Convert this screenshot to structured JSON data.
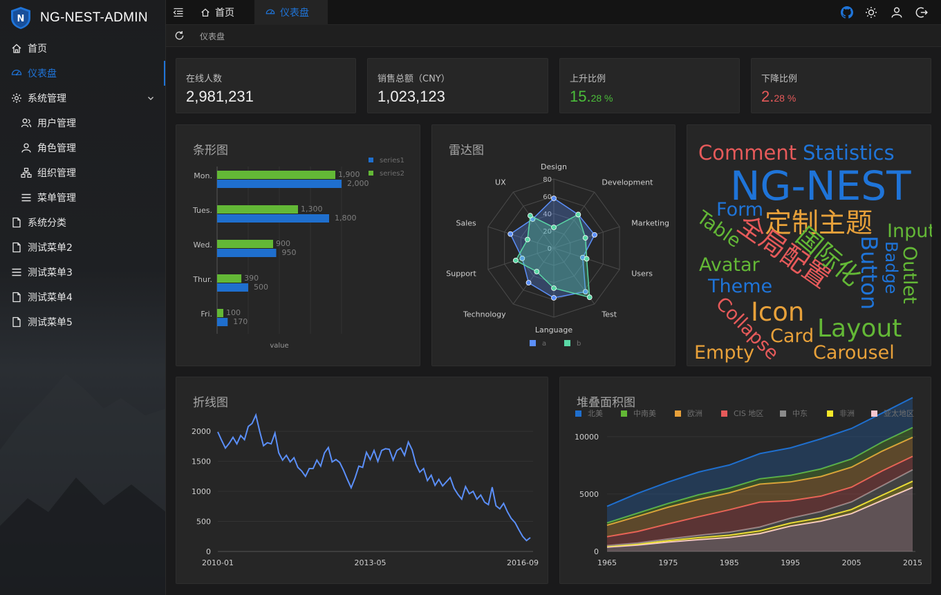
{
  "app": {
    "title": "NG-NEST-ADMIN"
  },
  "sidebar": {
    "items": [
      {
        "label": "首页",
        "icon": "home-icon"
      },
      {
        "label": "仪表盘",
        "icon": "dashboard-icon",
        "active": true
      },
      {
        "label": "系统管理",
        "icon": "gear-icon",
        "expandable": true
      },
      {
        "label": "用户管理",
        "icon": "user-group-icon"
      },
      {
        "label": "角色管理",
        "icon": "user-icon"
      },
      {
        "label": "组织管理",
        "icon": "org-icon"
      },
      {
        "label": "菜单管理",
        "icon": "menu-icon"
      },
      {
        "label": "系统分类",
        "icon": "file-icon"
      },
      {
        "label": "测试菜单2",
        "icon": "file-icon"
      },
      {
        "label": "测试菜单3",
        "icon": "menu-icon"
      },
      {
        "label": "测试菜单4",
        "icon": "file-icon"
      },
      {
        "label": "测试菜单5",
        "icon": "file-icon"
      }
    ]
  },
  "tabs": [
    {
      "label": "首页",
      "icon": "home-icon"
    },
    {
      "label": "仪表盘",
      "icon": "dashboard-icon",
      "active": true
    }
  ],
  "breadcrumb": {
    "current": "仪表盘"
  },
  "colors": {
    "accent": "#1f74d8",
    "up": "#4bbf3a",
    "down": "#e65a5a"
  },
  "stats": [
    {
      "label": "在线人数",
      "value": "2,981,231"
    },
    {
      "label": "销售总额（CNY）",
      "value": "1,023,123"
    },
    {
      "label": "上升比例",
      "int": "15.",
      "dec": "28 %"
    },
    {
      "label": "下降比例",
      "int": "2.",
      "dec": "28 %"
    }
  ],
  "charts": {
    "bar": {
      "title": "条形图"
    },
    "radar": {
      "title": "雷达图"
    },
    "line": {
      "title": "折线图"
    },
    "area": {
      "title": "堆叠面积图"
    }
  },
  "chart_data": [
    {
      "type": "bar",
      "orientation": "horizontal",
      "categories": [
        "Mon.",
        "Tues.",
        "Wed.",
        "Thur.",
        "Fri."
      ],
      "series": [
        {
          "name": "series1",
          "color": "#1f6fce",
          "values": [
            2000,
            1800,
            950,
            500,
            170
          ]
        },
        {
          "name": "series2",
          "color": "#63b836",
          "values": [
            1900,
            1300,
            900,
            390,
            100
          ]
        }
      ],
      "data_labels": {
        "series1": [
          "2,000",
          "1,800",
          "950",
          "500",
          "170"
        ],
        "series2": [
          "1,900",
          "1,300",
          "900",
          "390",
          "100"
        ]
      },
      "xlabel": "value",
      "xlim": [
        0,
        2000
      ],
      "legend": "top-right"
    },
    {
      "type": "radar",
      "indicators": [
        "Design",
        "Development",
        "Marketing",
        "Users",
        "Test",
        "Language",
        "Technology",
        "Support",
        "Sales",
        "UX"
      ],
      "ticks": [
        "0",
        "20",
        "40",
        "60",
        "80"
      ],
      "max": 100,
      "series": [
        {
          "name": "a",
          "color": "#5b8ff9",
          "values": [
            72,
            60,
            62,
            44,
            78,
            72,
            62,
            48,
            66,
            52
          ]
        },
        {
          "name": "b",
          "color": "#5ad8a6",
          "values": [
            30,
            60,
            48,
            50,
            88,
            58,
            42,
            58,
            40,
            58
          ]
        }
      ],
      "legend": "bottom-center"
    },
    {
      "type": "wordcloud",
      "words": [
        {
          "text": "NG-NEST",
          "color": "#1f74d8"
        },
        {
          "text": "Comment",
          "color": "#e65a5a"
        },
        {
          "text": "Statistics",
          "color": "#1f74d8"
        },
        {
          "text": "Form",
          "color": "#1f74d8"
        },
        {
          "text": "定制主题",
          "color": "#e8a13a"
        },
        {
          "text": "Table",
          "color": "#63b836"
        },
        {
          "text": "全局配置",
          "color": "#e65a5a"
        },
        {
          "text": "国际化",
          "color": "#63b836"
        },
        {
          "text": "Button",
          "color": "#1f74d8"
        },
        {
          "text": "Input",
          "color": "#63b836"
        },
        {
          "text": "Badge",
          "color": "#1f74d8"
        },
        {
          "text": "Outlet",
          "color": "#63b836"
        },
        {
          "text": "Avatar",
          "color": "#63b836"
        },
        {
          "text": "Theme",
          "color": "#1f74d8"
        },
        {
          "text": "Icon",
          "color": "#e8a13a"
        },
        {
          "text": "Collapse",
          "color": "#e65a5a"
        },
        {
          "text": "Layout",
          "color": "#63b836"
        },
        {
          "text": "Card",
          "color": "#e8a13a"
        },
        {
          "text": "Empty",
          "color": "#e8a13a"
        },
        {
          "text": "Carousel",
          "color": "#e8a13a"
        }
      ]
    },
    {
      "type": "line",
      "color": "#5b8ff9",
      "x_ticks": [
        "2010-01",
        "2013-05",
        "2016-09"
      ],
      "y_ticks": [
        "0",
        "500",
        "1000",
        "1500",
        "2000"
      ],
      "ylim": [
        0,
        2300
      ],
      "x": [
        "2010-01",
        "2010-02",
        "2010-03",
        "2010-04",
        "2010-05",
        "2010-06",
        "2010-07",
        "2010-08",
        "2010-09",
        "2010-10",
        "2010-11",
        "2010-12",
        "2011-01",
        "2011-02",
        "2011-03",
        "2011-04",
        "2011-05",
        "2011-06",
        "2011-07",
        "2011-08",
        "2011-09",
        "2011-10",
        "2011-11",
        "2011-12",
        "2012-01",
        "2012-02",
        "2012-03",
        "2012-04",
        "2012-05",
        "2012-06",
        "2012-07",
        "2012-08",
        "2012-09",
        "2012-10",
        "2012-11",
        "2012-12",
        "2013-01",
        "2013-02",
        "2013-03",
        "2013-04",
        "2013-05",
        "2013-06",
        "2013-07",
        "2013-08",
        "2013-09",
        "2013-10",
        "2013-11",
        "2013-12",
        "2014-01",
        "2014-02",
        "2014-03",
        "2014-04",
        "2014-05",
        "2014-06",
        "2014-07",
        "2014-08",
        "2014-09",
        "2014-10",
        "2014-11",
        "2014-12",
        "2015-01",
        "2015-02",
        "2015-03",
        "2015-04",
        "2015-05",
        "2015-06",
        "2015-07",
        "2015-08",
        "2015-09",
        "2015-10",
        "2015-11",
        "2015-12",
        "2016-01",
        "2016-02",
        "2016-03",
        "2016-04",
        "2016-05",
        "2016-06",
        "2016-07",
        "2016-08",
        "2016-09",
        "2016-10",
        "2016-11"
      ],
      "values": [
        1990,
        1850,
        1720,
        1800,
        1900,
        1790,
        1930,
        1860,
        2080,
        2130,
        2270,
        2000,
        1760,
        1810,
        1790,
        1970,
        1640,
        1520,
        1600,
        1490,
        1560,
        1400,
        1340,
        1250,
        1380,
        1380,
        1520,
        1420,
        1640,
        1730,
        1490,
        1530,
        1480,
        1350,
        1200,
        1060,
        1220,
        1420,
        1400,
        1650,
        1530,
        1680,
        1500,
        1680,
        1710,
        1700,
        1520,
        1680,
        1720,
        1600,
        1820,
        1690,
        1450,
        1320,
        1380,
        1180,
        1270,
        1100,
        1200,
        1090,
        1160,
        1230,
        1050,
        950,
        870,
        1080,
        960,
        1000,
        870,
        940,
        820,
        780,
        1070,
        760,
        710,
        800,
        660,
        550,
        480,
        360,
        250,
        180,
        230
      ],
      "grid": true
    },
    {
      "type": "area",
      "stacked": true,
      "x": [
        1965,
        1970,
        1975,
        1980,
        1985,
        1990,
        1995,
        2000,
        2005,
        2010,
        2015
      ],
      "x_ticks": [
        "1965",
        "1975",
        "1985",
        "1995",
        "2005",
        "2015"
      ],
      "y_ticks": [
        "0",
        "5000",
        "10000"
      ],
      "ylim": [
        0,
        13000
      ],
      "series": [
        {
          "name": "亚太地区",
          "color": "#f5c6cf",
          "values": [
            380,
            560,
            820,
            1030,
            1220,
            1560,
            2210,
            2640,
            3300,
            4450,
            5580
          ]
        },
        {
          "name": "非洲",
          "color": "#f7e829",
          "values": [
            70,
            90,
            130,
            180,
            200,
            240,
            270,
            300,
            360,
            450,
            540
          ]
        },
        {
          "name": "中东",
          "color": "#8b8b8b",
          "values": [
            60,
            90,
            140,
            200,
            260,
            330,
            420,
            540,
            660,
            820,
            1000
          ]
        },
        {
          "name": "CIS 地区",
          "color": "#e65a5a",
          "values": [
            770,
            1000,
            1310,
            1620,
            1950,
            2170,
            1520,
            1340,
            1280,
            1290,
            1160
          ]
        },
        {
          "name": "欧洲",
          "color": "#e8a13a",
          "values": [
            1010,
            1320,
            1460,
            1510,
            1480,
            1570,
            1640,
            1710,
            1740,
            1730,
            1660
          ]
        },
        {
          "name": "中南美",
          "color": "#63b836",
          "values": [
            200,
            280,
            330,
            400,
            420,
            460,
            570,
            660,
            720,
            790,
            860
          ]
        },
        {
          "name": "北美",
          "color": "#1f6fce",
          "values": [
            1440,
            1720,
            1850,
            1980,
            2000,
            2190,
            2390,
            2620,
            2650,
            2520,
            2600
          ]
        }
      ],
      "legend_order": [
        "北美",
        "中南美",
        "欧洲",
        "CIS 地区",
        "中东",
        "非洲",
        "亚太地区"
      ],
      "legend": "top"
    }
  ]
}
